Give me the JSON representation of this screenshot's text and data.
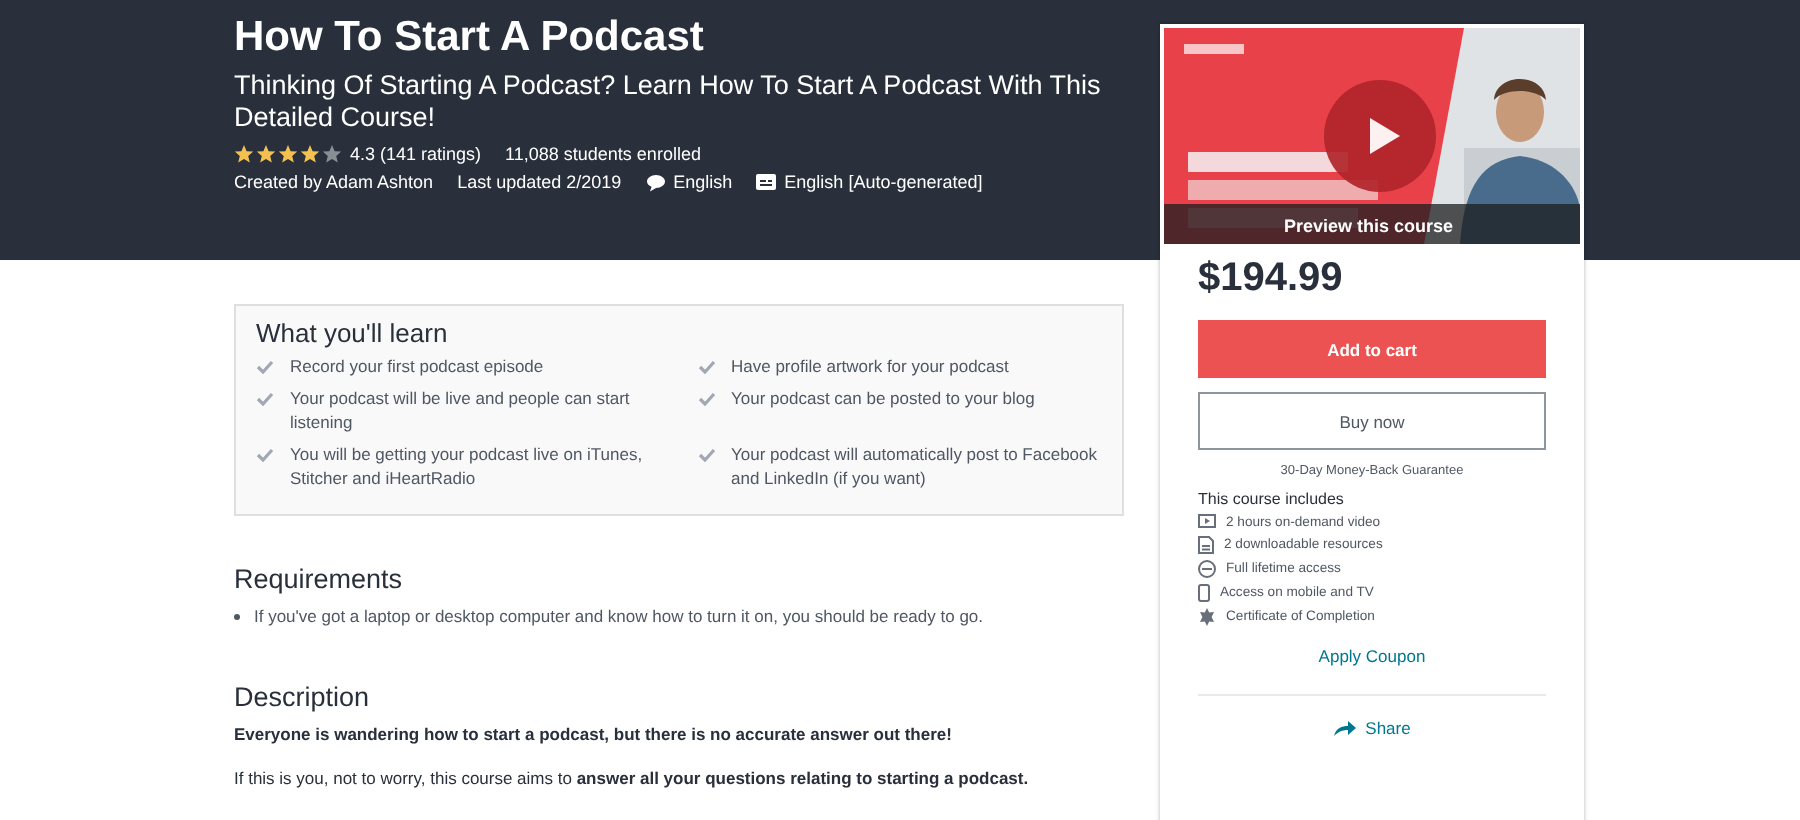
{
  "header": {
    "title": "How To Start A Podcast",
    "subtitle": "Thinking Of Starting A Podcast? Learn How To Start A Podcast With This Detailed Course!",
    "stars": 4,
    "rating": "4.3 (141 ratings)",
    "enrolled": "11,088 students enrolled",
    "created_by": "Created by Adam Ashton",
    "last_updated": "Last updated 2/2019",
    "language": "English",
    "captions": "English [Auto-generated]"
  },
  "learn": {
    "title": "What you'll learn",
    "items": [
      {
        "text": "Record your first podcast episode"
      },
      {
        "text": "Have profile artwork for your podcast"
      },
      {
        "text": "Your podcast will be live and people can start listening"
      },
      {
        "text": "Your podcast can be posted to your blog"
      },
      {
        "text": "You will be getting your podcast live on iTunes, Stitcher and iHeartRadio"
      },
      {
        "text": "Your podcast will automatically post to Facebook and LinkedIn (if you want)"
      }
    ]
  },
  "requirements": {
    "title": "Requirements",
    "items": [
      "If you've got a laptop or desktop computer and know how to turn it on, you should be ready to go."
    ]
  },
  "description": {
    "title": "Description",
    "paragraphs": [
      {
        "text": "Everyone is wandering how to start a podcast, but there is no accurate answer out there!",
        "bold": true
      },
      {
        "text": "If this is you, not to worry, this course aims to **answer all your questions relating to starting a podcast.**",
        "bold": false
      }
    ]
  },
  "sidebar": {
    "preview": {
      "kind": "picture",
      "label": "Preview this course"
    },
    "price": "$194.99",
    "add_to_cart": "Add to cart",
    "buy_now": "Buy now",
    "guarantee": "30-Day Money-Back Guarantee",
    "includes_title": "This course includes",
    "includes": [
      {
        "kind": "video",
        "text": "2 hours on-demand video"
      },
      {
        "kind": "file",
        "text": "2 downloadable resources"
      },
      {
        "kind": "lifetime",
        "text": "Full lifetime access"
      },
      {
        "kind": "mobile",
        "text": "Access on mobile and TV"
      },
      {
        "kind": "certificate",
        "text": "Certificate of Completion"
      }
    ],
    "coupon": "Apply Coupon",
    "share": "Share"
  }
}
